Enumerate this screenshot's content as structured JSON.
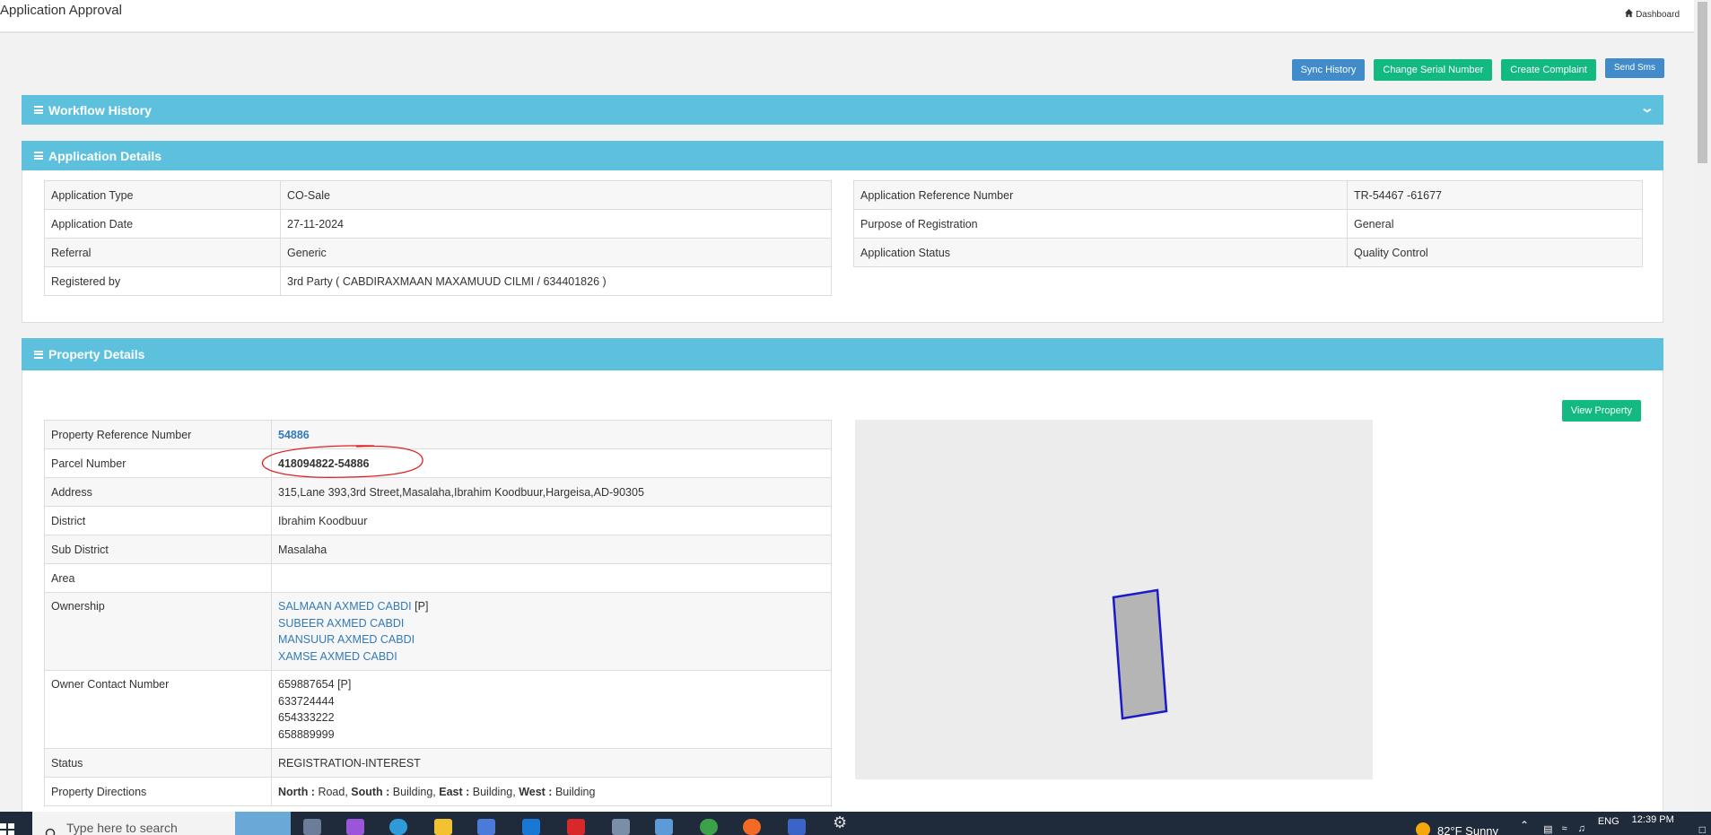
{
  "header": {
    "title": "Application Approval",
    "dashboard_label": "Dashboard"
  },
  "actions": {
    "sync_history": "Sync History",
    "change_serial": "Change Serial Number",
    "create_complaint": "Create Complaint",
    "send_sms": "Send Sms"
  },
  "workflow": {
    "title": "Workflow History"
  },
  "application": {
    "title": "Application Details",
    "left": [
      {
        "label": "Application Type",
        "value": "CO-Sale"
      },
      {
        "label": "Application Date",
        "value": "27-11-2024"
      },
      {
        "label": "Referral",
        "value": "Generic"
      },
      {
        "label": "Registered by",
        "value": "3rd Party ( CABDIRAXMAAN MAXAMUUD CILMI / 634401826 )"
      }
    ],
    "right": [
      {
        "label": "Application Reference Number",
        "value": "TR-54467 -61677"
      },
      {
        "label": "Purpose of Registration",
        "value": "General"
      },
      {
        "label": "Application Status",
        "value": "Quality Control"
      }
    ]
  },
  "property": {
    "title": "Property Details",
    "view_property": "View Property",
    "ref_label": "Property Reference Number",
    "ref_value": "54886",
    "parcel_label": "Parcel Number",
    "parcel_value": "418094822-54886",
    "address_label": "Address",
    "address_value": "315,Lane 393,3rd Street,Masalaha,Ibrahim Koodbuur,Hargeisa,AD-90305",
    "district_label": "District",
    "district_value": "Ibrahim Koodbuur",
    "subdistrict_label": "Sub District",
    "subdistrict_value": "Masalaha",
    "area_label": "Area",
    "area_value": "",
    "ownership_label": "Ownership",
    "owners": [
      "SALMAAN AXMED CABDI",
      "SUBEER AXMED CABDI",
      "MANSUUR AXMED CABDI",
      "XAMSE AXMED CABDI"
    ],
    "primary_tag": "[P]",
    "contact_label": "Owner Contact Number",
    "contacts": [
      "659887654",
      "633724444",
      "654333222",
      "658889999"
    ],
    "status_label": "Status",
    "status_value": "REGISTRATION-INTEREST",
    "directions_label": "Property Directions",
    "directions": {
      "north_k": "North :",
      "north_v": " Road, ",
      "south_k": "South :",
      "south_v": " Building, ",
      "east_k": "East :",
      "east_v": " Building, ",
      "west_k": "West :",
      "west_v": " Building"
    }
  },
  "taskbar": {
    "search_placeholder": "Type here to search",
    "weather": "82°F  Sunny",
    "lang": "ENG",
    "time": "12:39 PM"
  },
  "colors": {
    "panel_header": "#5dc1dd",
    "btn_blue": "#428bca",
    "btn_green": "#12b980",
    "annotation": "#e02020",
    "parcel_stroke": "#1a1acc"
  }
}
